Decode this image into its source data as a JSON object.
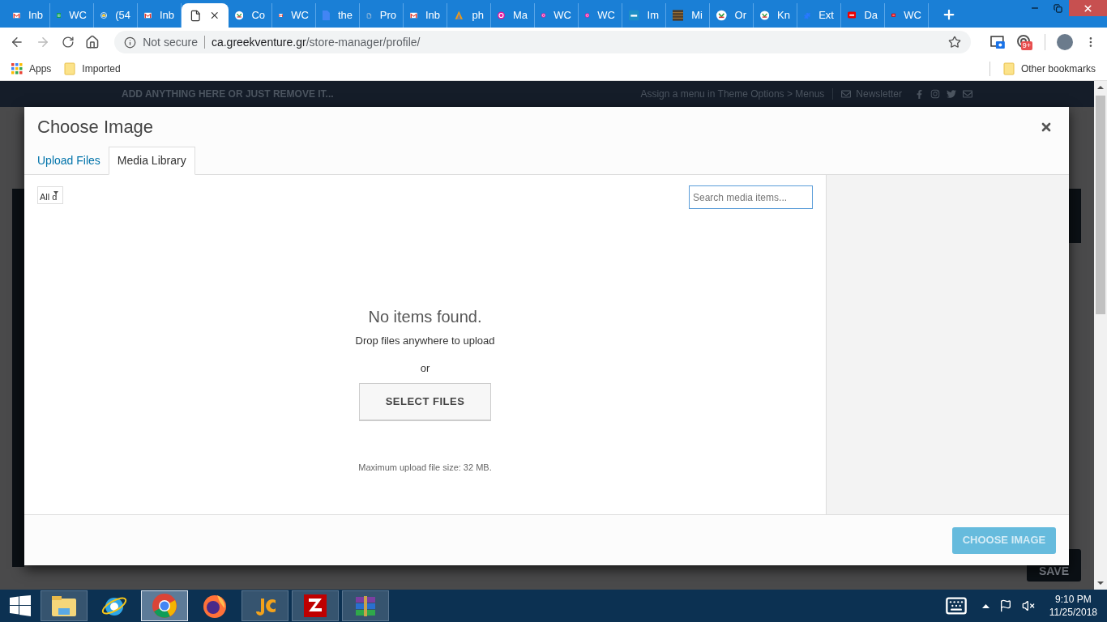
{
  "browser": {
    "tabs": [
      {
        "title": "Inb",
        "kind": "gmail",
        "selected": false
      },
      {
        "title": "WC",
        "kind": "sheets",
        "selected": false
      },
      {
        "title": "(54",
        "kind": "mail",
        "selected": false
      },
      {
        "title": "Inb",
        "kind": "gmail",
        "selected": false
      },
      {
        "kind": "page",
        "selected": true
      },
      {
        "title": "Co",
        "kind": "badge",
        "selected": false
      },
      {
        "title": "WC",
        "kind": "gmail",
        "selected": false
      },
      {
        "title": "the",
        "kind": "doc",
        "selected": false
      },
      {
        "title": "Pro",
        "kind": "page",
        "selected": false
      },
      {
        "title": "Inb",
        "kind": "gmail",
        "selected": false
      },
      {
        "title": "ph",
        "kind": "sail",
        "selected": false
      },
      {
        "title": "Ma",
        "kind": "ring",
        "selected": false
      },
      {
        "title": "WC",
        "kind": "ring",
        "selected": false
      },
      {
        "title": "WC",
        "kind": "ring",
        "selected": false
      },
      {
        "title": "Im",
        "kind": "square",
        "selected": false
      },
      {
        "title": "Mi",
        "kind": "photo",
        "selected": false
      },
      {
        "title": "Or",
        "kind": "badge",
        "selected": false
      },
      {
        "title": "Kn",
        "kind": "badge",
        "selected": false
      },
      {
        "title": "Ext",
        "kind": "puzzle",
        "selected": false
      },
      {
        "title": "Da",
        "kind": "tag",
        "selected": false
      },
      {
        "title": "WC",
        "kind": "tag",
        "selected": false
      }
    ],
    "security": "Not secure",
    "url_host": "ca.greekventure.gr",
    "url_path": "/store-manager/profile/",
    "extension_badge": "9+",
    "bookmarks": [
      {
        "label": "Apps",
        "kind": "apps"
      },
      {
        "label": "Imported",
        "kind": "folder"
      }
    ],
    "other_bookmarks": "Other bookmarks"
  },
  "site_topbar": {
    "promo": "ADD ANYTHING HERE OR JUST REMOVE IT...",
    "menu_hint": "Assign a menu in Theme Options > Menus",
    "newsletter": "Newsletter"
  },
  "page_behind": {
    "save_button": "SAVE"
  },
  "modal": {
    "title": "Choose Image",
    "tabs": [
      {
        "label": "Upload Files",
        "selected": false
      },
      {
        "label": "Media Library",
        "selected": true
      }
    ],
    "filter": "All d",
    "search": {
      "placeholder": "Search media items..."
    },
    "empty": {
      "heading": "No items found.",
      "hint": "Drop files anywhere to upload",
      "or": "or",
      "button": "SELECT FILES",
      "max_size": "Maximum upload file size: 32 MB."
    },
    "choose_button": {
      "label": "CHOOSE IMAGE",
      "disabled": true
    }
  },
  "taskbar": {
    "apps": [
      {
        "kind": "explorer",
        "running": true,
        "selected": false
      },
      {
        "kind": "ie",
        "running": false,
        "selected": false
      },
      {
        "kind": "chrome",
        "running": true,
        "selected": true
      },
      {
        "kind": "firefox",
        "running": false,
        "selected": false
      },
      {
        "kind": "je",
        "running": true,
        "selected": false
      },
      {
        "kind": "filezilla",
        "running": true,
        "selected": false
      },
      {
        "kind": "winrar",
        "running": true,
        "selected": false
      }
    ],
    "time": "9:10 PM",
    "date": "11/25/2018"
  }
}
